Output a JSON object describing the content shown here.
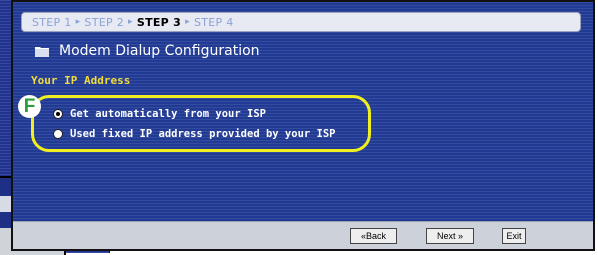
{
  "steps": [
    "STEP 1",
    "STEP 2",
    "STEP 3",
    "STEP 4"
  ],
  "active_step": "STEP 3",
  "step_separator": "▸",
  "title": "Modem Dialup Configuration",
  "section_label": "Your IP Address",
  "options": [
    {
      "label": "Get automatically from your ISP",
      "selected": true
    },
    {
      "label": "Used fixed IP address provided by your ISP",
      "selected": false
    }
  ],
  "annotation_badge": "F",
  "buttons": {
    "back": "«Back",
    "next": "Next »",
    "exit": "Exit"
  },
  "colors": {
    "panel": "#213a94",
    "highlight": "#f0f020",
    "section": "#f2dc3b",
    "badge_text": "#2a9e3a"
  }
}
